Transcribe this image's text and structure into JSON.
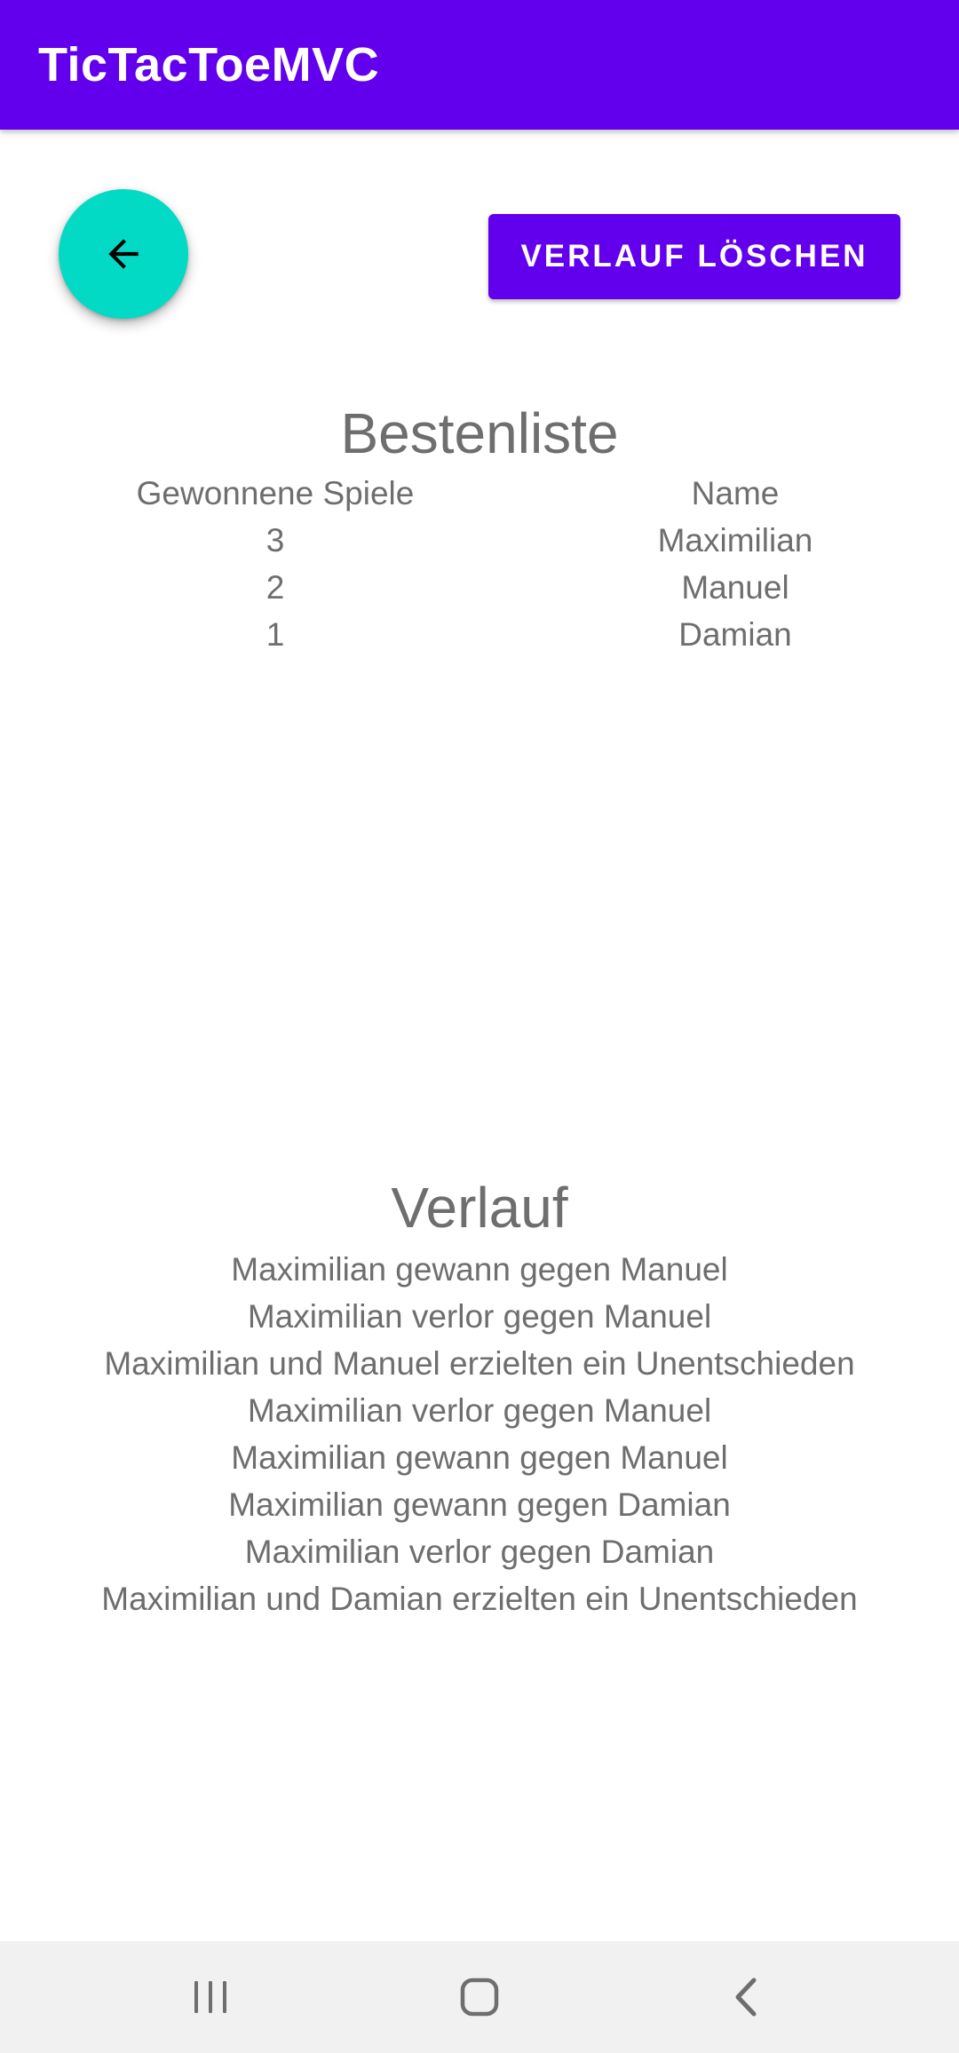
{
  "app": {
    "title": "TicTacToeMVC",
    "colors": {
      "primary": "#6200EE",
      "accent": "#03DAC5",
      "text_secondary": "#6E6E6E",
      "nav_bar": "#F1F1F1"
    }
  },
  "toolbar": {
    "back_icon": "arrow-left-icon",
    "clear_label": "VERLAUF LÖSCHEN"
  },
  "leaderboard": {
    "title": "Bestenliste",
    "headers": [
      "Gewonnene Spiele",
      "Name"
    ],
    "rows": [
      [
        "3",
        "Maximilian"
      ],
      [
        "2",
        "Manuel"
      ],
      [
        "1",
        "Damian"
      ]
    ]
  },
  "history": {
    "title": "Verlauf",
    "entries": [
      "Maximilian gewann gegen Manuel",
      "Maximilian verlor gegen Manuel",
      "Maximilian und Manuel erzielten ein Unentschieden",
      "Maximilian verlor gegen Manuel",
      "Maximilian gewann gegen Manuel",
      "Maximilian gewann gegen Damian",
      "Maximilian verlor gegen Damian",
      "Maximilian und Damian erzielten ein Unentschieden"
    ]
  },
  "navigation": {
    "recents_icon": "recent-apps-icon",
    "home_icon": "home-icon",
    "back_icon": "back-chevron-icon"
  }
}
